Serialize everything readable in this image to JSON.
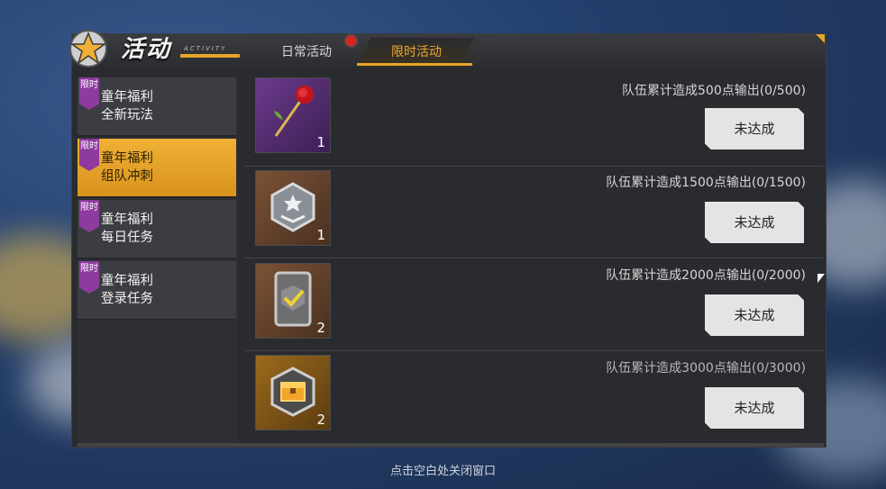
{
  "header": {
    "title": "活动",
    "subtitle": "ACTIVITY",
    "tabs": [
      {
        "label": "日常活动",
        "active": false,
        "has_dot": true
      },
      {
        "label": "限时活动",
        "active": true
      }
    ]
  },
  "sidebar": {
    "items": [
      {
        "badge": "限时",
        "line1": "童年福利",
        "line2": "全新玩法",
        "active": false
      },
      {
        "badge": "限时",
        "line1": "童年福利",
        "line2": "组队冲刺",
        "active": true
      },
      {
        "badge": "限时",
        "line1": "童年福利",
        "line2": "每日任务",
        "active": false
      },
      {
        "badge": "限时",
        "line1": "童年福利",
        "line2": "登录任务",
        "active": false
      }
    ]
  },
  "rewards": [
    {
      "icon": "rose-icon",
      "count": "1",
      "desc": "队伍累计造成500点输出(0/500)",
      "button": "未达成"
    },
    {
      "icon": "rank-badge-icon",
      "count": "1",
      "desc": "队伍累计造成1500点输出(0/1500)",
      "button": "未达成"
    },
    {
      "icon": "check-card-icon",
      "count": "2",
      "desc": "队伍累计造成2000点输出(0/2000)",
      "button": "未达成"
    },
    {
      "icon": "gold-chest-icon",
      "count": "2",
      "desc": "队伍累计造成3000点输出(0/3000)",
      "button": "未达成"
    }
  ],
  "footer": {
    "close_hint": "点击空白处关闭窗口"
  },
  "colors": {
    "accent": "#e6a52c",
    "badge": "#8e3a9e",
    "panel": "#2a2b2f",
    "alert_dot": "#d4241c"
  }
}
